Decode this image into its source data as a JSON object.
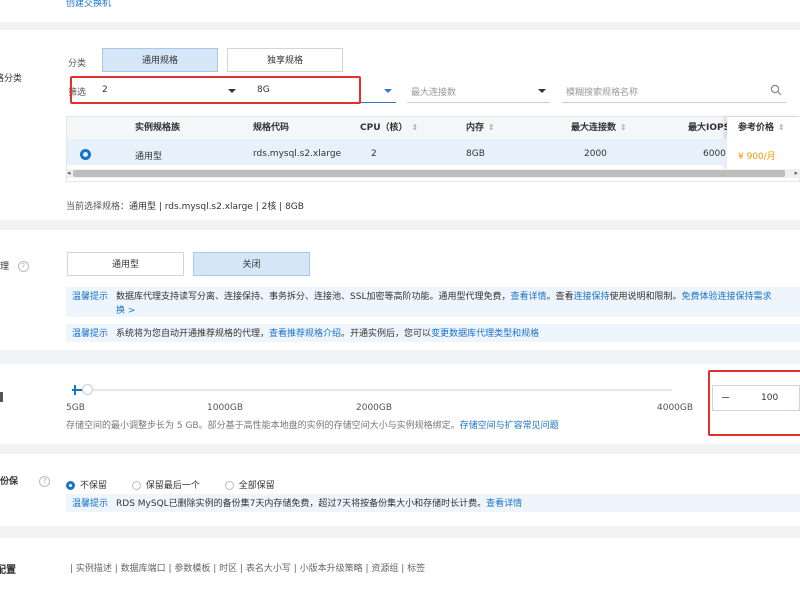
{
  "top": {
    "link": "创建交换机"
  },
  "spec": {
    "section_label": "规格分类",
    "classify_label": "分类",
    "tabs": [
      "通用规格",
      "独享规格"
    ],
    "filter_label": "筛选",
    "filter_cpu": "2",
    "filter_mem": "8G",
    "filter_conn_placeholder": "最大连接数",
    "search_placeholder": "模糊搜索规格名称",
    "table": {
      "headers": [
        "实例规格族",
        "规格代码",
        "CPU（核）",
        "内存",
        "最大连接数",
        "最大IOPS",
        "参考价格"
      ],
      "row": [
        "通用型",
        "rds.mysql.s2.xlarge",
        "2",
        "8GB",
        "2000",
        "6000",
        "¥ 900/月"
      ]
    },
    "current_label": "当前选择规格：",
    "current_value": "通用型 | rds.mysql.s2.xlarge | 2核 | 8GB"
  },
  "proxy": {
    "section_label": "理",
    "buttons": [
      "通用型",
      "关闭"
    ],
    "tip_key": "温馨提示",
    "tip1_text": "数据库代理支持读写分离、连接保持、事务拆分、连接池、SSL加密等高阶功能。通用型代理免费，",
    "tip1_link1": "查看详情",
    "tip1_mid": "。查看",
    "tip1_link2": "连接保持",
    "tip1_mid2": "使用说明和限制。",
    "tip1_link3": "免费体验连接保持需求",
    "tip1_link4": "换 >",
    "tip2_text": "系统将为您自动开通推荐规格的代理，",
    "tip2_link1": "查看推荐规格介绍",
    "tip2_mid": "。开通实例后，您可以",
    "tip2_link2": "变更数据库代理类型和规格"
  },
  "storage": {
    "ticks": [
      "5GB",
      "1000GB",
      "2000GB",
      "4000GB"
    ],
    "hint": "存储空间的最小调整步长为 5 GB。部分基于高性能本地盘的实例的存储空间大小与实例规格绑定。",
    "hint_link": "存储空间与扩容常见问题",
    "minus": "−",
    "value": "100"
  },
  "backup": {
    "section_label": "份保",
    "options": [
      "不保留",
      "保留最后一个",
      "全部保留"
    ],
    "selected_index": 0,
    "tip_key": "温馨提示",
    "tip_text": "RDS MySQL已删除实例的备份集7天内存储免费，超过7天将按备份集大小和存储时长计费。",
    "tip_link": "查看详情"
  },
  "config": {
    "section_label": "配置",
    "links": "| 实例描述 | 数据库端口 | 参数模板 | 时区 | 表名大小写 | 小版本升级策略 | 资源组 | 标签"
  }
}
